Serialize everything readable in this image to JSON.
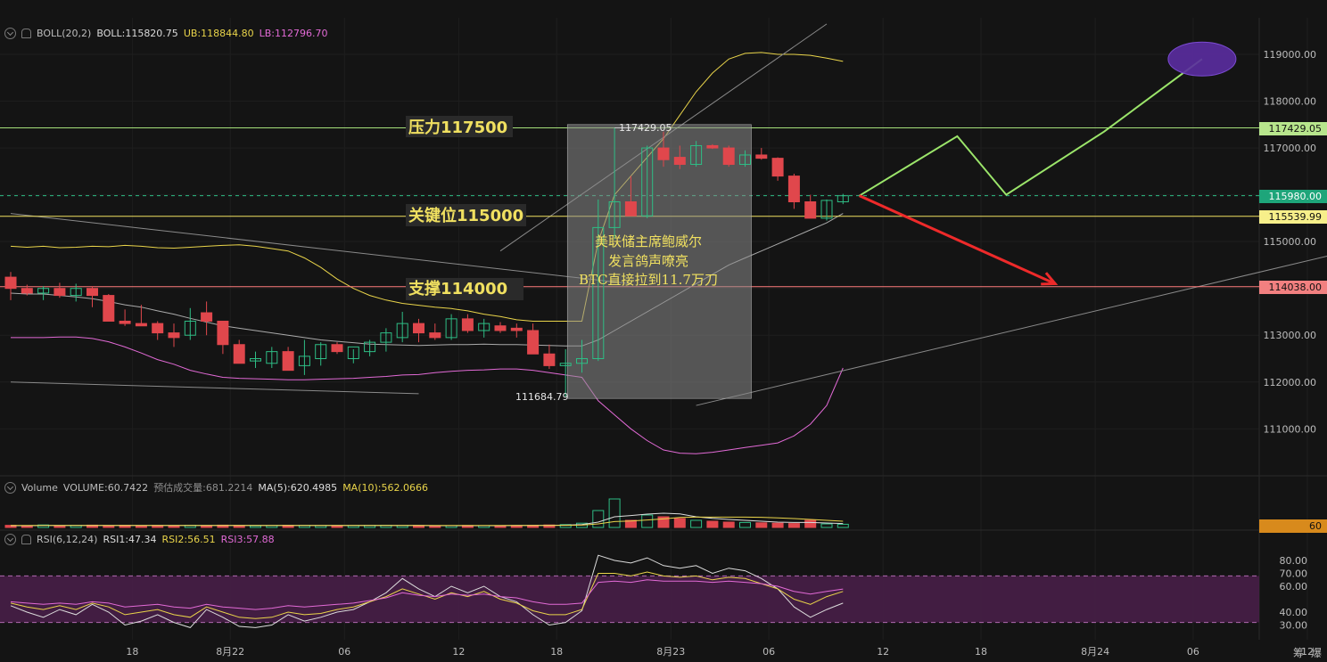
{
  "indicators": {
    "boll": {
      "label": "BOLL(20,2)",
      "mid": "BOLL:115820.75",
      "ub": "UB:118844.80",
      "lb": "LB:112796.70"
    },
    "volume": {
      "label": "Volume",
      "value": "VOLUME:60.7422",
      "estimate": "预估成交量:681.2214",
      "ma5": "MA(5):620.4985",
      "ma10": "MA(10):562.0666",
      "axis_value": "60"
    },
    "rsi": {
      "label": "RSI(6,12,24)",
      "rsi1": "RSI1:47.34",
      "rsi2": "RSI2:56.51",
      "rsi3": "RSI3:57.88"
    }
  },
  "annotations": {
    "resistance": "压力117500",
    "key_level": "关键位115000",
    "support": "支撑114000",
    "news_line1": "美联储主席鲍威尔",
    "news_line2": "发言鸽声嘹亮",
    "news_line3": "BTC直接拉到11.7万刀",
    "high_label": "117429.05",
    "low_label": "111684.79"
  },
  "price_tags": {
    "t117429": "117429.05",
    "t115980": "115980.00",
    "t115539": "115539.99",
    "t114038": "114038.00"
  },
  "bottom_icons": {
    "a": "筹",
    "b": "爆"
  },
  "colors": {
    "up": "#2ebd85",
    "down": "#e0474c",
    "boll_mid": "#cfcfcf",
    "boll_up": "#e9d44a",
    "boll_low": "#e26ad6",
    "resistance": "#a5e07a",
    "key": "#f0e060",
    "support": "#ff7d7d",
    "forecast": "#9be56a",
    "arrow": "#ee2a2a"
  },
  "chart_data": [
    {
      "type": "candlestick",
      "title": "",
      "y_axis_ticks": [
        119000,
        118000,
        117000,
        116000,
        115000,
        114000,
        113000,
        112000,
        111000
      ],
      "y_axis_labels": [
        "119000.00",
        "118000.00",
        "117000.00",
        "116000.00",
        "115000.00",
        "114000.00",
        "113000.00",
        "112000.00",
        "111000.00"
      ],
      "ylim": [
        110400,
        120050
      ],
      "x_ticks": [
        {
          "i": 8,
          "label": "18"
        },
        {
          "i": 14,
          "label": "8月22"
        },
        {
          "i": 21,
          "label": "06"
        },
        {
          "i": 28,
          "label": "12"
        },
        {
          "i": 34,
          "label": "18"
        },
        {
          "i": 41,
          "label": "8月23"
        },
        {
          "i": 47,
          "label": "06"
        },
        {
          "i": 54,
          "label": "12"
        },
        {
          "i": 60,
          "label": "18"
        },
        {
          "i": 67,
          "label": "8月24"
        },
        {
          "i": 73,
          "label": "06"
        },
        {
          "i": 80,
          "label": "12"
        }
      ],
      "levels": [
        {
          "name": "压力",
          "value": 117429.05
        },
        {
          "name": "关键位",
          "value": 115539.99
        },
        {
          "name": "支撑",
          "value": 114038.0
        },
        {
          "name": "current",
          "value": 115980.0
        }
      ],
      "candles": [
        [
          114240,
          114350,
          113750,
          114000
        ],
        [
          114000,
          114080,
          113850,
          113900
        ],
        [
          113900,
          114050,
          113750,
          114000
        ],
        [
          114000,
          114120,
          113800,
          113850
        ],
        [
          113850,
          114100,
          113720,
          114000
        ],
        [
          114000,
          114050,
          113600,
          113850
        ],
        [
          113850,
          113880,
          113500,
          113300
        ],
        [
          113300,
          113550,
          113200,
          113250
        ],
        [
          113250,
          113650,
          113200,
          113200
        ],
        [
          113250,
          113300,
          112900,
          113050
        ],
        [
          113050,
          113250,
          112750,
          112950
        ],
        [
          113000,
          113580,
          112900,
          113300
        ],
        [
          113480,
          113720,
          113000,
          113300
        ],
        [
          113300,
          113300,
          112600,
          112800
        ],
        [
          112800,
          112900,
          112450,
          112400
        ],
        [
          112450,
          112650,
          112300,
          112500
        ],
        [
          112400,
          112750,
          112300,
          112650
        ],
        [
          112650,
          112750,
          112250,
          112250
        ],
        [
          112350,
          112900,
          112150,
          112550
        ],
        [
          112500,
          112850,
          112350,
          112800
        ],
        [
          112800,
          112850,
          112600,
          112650
        ],
        [
          112500,
          112700,
          112400,
          112750
        ],
        [
          112650,
          112900,
          112550,
          112850
        ],
        [
          112850,
          113150,
          112650,
          113050
        ],
        [
          112950,
          113500,
          112850,
          113250
        ],
        [
          113250,
          113350,
          112850,
          113050
        ],
        [
          113050,
          113250,
          112900,
          112950
        ],
        [
          112950,
          113450,
          112900,
          113350
        ],
        [
          113350,
          113450,
          113050,
          113100
        ],
        [
          113100,
          113350,
          112950,
          113250
        ],
        [
          113200,
          113280,
          113050,
          113100
        ],
        [
          113150,
          113250,
          112950,
          113100
        ],
        [
          113100,
          113250,
          112650,
          112600
        ],
        [
          112600,
          112800,
          112280,
          112350
        ],
        [
          112350,
          112700,
          111684.79,
          112400
        ],
        [
          112400,
          112900,
          112200,
          112500
        ],
        [
          112500,
          115900,
          112450,
          115300
        ],
        [
          115300,
          117429.05,
          115050,
          115850
        ],
        [
          115850,
          116400,
          115650,
          115550
        ],
        [
          115550,
          117050,
          115500,
          117000
        ],
        [
          117000,
          117350,
          116600,
          116750
        ],
        [
          116800,
          117050,
          116550,
          116650
        ],
        [
          116650,
          117150,
          116600,
          117050
        ],
        [
          117050,
          117080,
          116980,
          117000
        ],
        [
          117000,
          117050,
          116600,
          116650
        ],
        [
          116650,
          116950,
          116600,
          116850
        ],
        [
          116850,
          117000,
          116750,
          116780
        ],
        [
          116780,
          116800,
          116300,
          116400
        ],
        [
          116400,
          116450,
          115700,
          115850
        ],
        [
          115850,
          116000,
          115500,
          115500
        ],
        [
          115500,
          115900,
          115450,
          115880
        ],
        [
          115850,
          116020,
          115800,
          115980
        ]
      ],
      "boll_upper": [
        114900,
        114880,
        114900,
        114870,
        114880,
        114900,
        114890,
        114920,
        114900,
        114870,
        114860,
        114880,
        114900,
        114920,
        114930,
        114900,
        114850,
        114800,
        114650,
        114450,
        114200,
        114000,
        113850,
        113750,
        113680,
        113640,
        113600,
        113570,
        113520,
        113450,
        113400,
        113330,
        113300,
        113300,
        113300,
        113300,
        115000,
        116000,
        116400,
        116800,
        117200,
        117700,
        118200,
        118600,
        118900,
        119020,
        119040,
        119000,
        119000,
        118980,
        118920,
        118850
      ],
      "boll_mid": [
        113900,
        113880,
        113880,
        113850,
        113820,
        113780,
        113720,
        113650,
        113600,
        113520,
        113450,
        113360,
        113280,
        113200,
        113150,
        113100,
        113050,
        113000,
        112950,
        112900,
        112870,
        112840,
        112810,
        112800,
        112790,
        112780,
        112790,
        112800,
        112800,
        112810,
        112800,
        112800,
        112790,
        112780,
        112770,
        112770,
        112900,
        113100,
        113300,
        113500,
        113700,
        113900,
        114100,
        114300,
        114500,
        114650,
        114800,
        114950,
        115100,
        115250,
        115400,
        115600
      ],
      "boll_lower": [
        112950,
        112950,
        112950,
        112960,
        112960,
        112930,
        112860,
        112750,
        112620,
        112480,
        112380,
        112250,
        112170,
        112100,
        112080,
        112070,
        112060,
        112050,
        112050,
        112060,
        112070,
        112080,
        112100,
        112120,
        112150,
        112160,
        112200,
        112230,
        112250,
        112260,
        112280,
        112280,
        112250,
        112200,
        112150,
        112100,
        111600,
        111300,
        111000,
        110750,
        110550,
        110480,
        110470,
        110500,
        110550,
        110600,
        110650,
        110700,
        110850,
        111100,
        111500,
        112300
      ],
      "trendlines": [
        {
          "from": [
            0,
            115600
          ],
          "to": [
            38,
            114100
          ]
        },
        {
          "from": [
            0,
            112000
          ],
          "to": [
            25,
            111750
          ]
        },
        {
          "from": [
            30,
            114800
          ],
          "to": [
            50,
            119650
          ]
        },
        {
          "from": [
            42,
            111500
          ],
          "to": [
            82,
            114800
          ]
        }
      ],
      "forecast_path": [
        [
          52,
          115980
        ],
        [
          58,
          117250
        ],
        [
          61,
          116000
        ],
        [
          67,
          117350
        ],
        [
          73,
          118900
        ]
      ],
      "forecast_target": [
        73,
        118900
      ],
      "bearish_arrow": {
        "from": [
          52,
          115980
        ],
        "to": [
          64,
          114100
        ]
      }
    },
    {
      "type": "bar",
      "title": "Volume",
      "values": [
        12,
        10,
        14,
        9,
        11,
        13,
        10,
        12,
        9,
        11,
        10,
        12,
        10,
        13,
        11,
        9,
        10,
        12,
        11,
        10,
        9,
        10,
        11,
        12,
        10,
        11,
        9,
        10,
        11,
        10,
        9,
        10,
        12,
        14,
        16,
        24,
        95,
        160,
        40,
        70,
        60,
        50,
        40,
        35,
        30,
        28,
        26,
        24,
        22,
        40,
        20,
        18
      ],
      "ma5": [
        10,
        10,
        11,
        11,
        11,
        11,
        11,
        11,
        11,
        11,
        11,
        11,
        11,
        11,
        11,
        11,
        11,
        11,
        11,
        11,
        11,
        11,
        11,
        11,
        11,
        11,
        10,
        10,
        10,
        10,
        10,
        11,
        11,
        12,
        13,
        16,
        30,
        60,
        67,
        75,
        80,
        76,
        60,
        51,
        45,
        40,
        35,
        30,
        28,
        28,
        25,
        22
      ],
      "ma10": [
        11,
        11,
        11,
        11,
        11,
        11,
        11,
        11,
        11,
        11,
        11,
        11,
        11,
        11,
        11,
        11,
        11,
        11,
        11,
        11,
        11,
        11,
        11,
        11,
        11,
        11,
        11,
        11,
        11,
        11,
        11,
        11,
        11,
        11,
        12,
        13,
        20,
        33,
        36,
        42,
        48,
        56,
        58,
        58,
        58,
        58,
        57,
        54,
        50,
        45,
        40,
        35
      ]
    },
    {
      "type": "line",
      "title": "RSI(6,12,24)",
      "ylim": [
        28,
        92
      ],
      "y_axis_labels": [
        "80.00",
        "70.00",
        "60.00",
        "40.00",
        "30.00"
      ],
      "y_axis_ticks": [
        80,
        70,
        60,
        40,
        30
      ],
      "band": [
        32,
        68
      ],
      "series": [
        {
          "name": "RSI1",
          "values": [
            45,
            40,
            36,
            42,
            38,
            46,
            40,
            30,
            33,
            38,
            32,
            28,
            42,
            36,
            29,
            28,
            30,
            38,
            33,
            36,
            40,
            42,
            48,
            55,
            66,
            58,
            52,
            60,
            55,
            60,
            52,
            48,
            38,
            30,
            32,
            41,
            84,
            80,
            78,
            82,
            76,
            74,
            76,
            70,
            74,
            72,
            66,
            58,
            44,
            36,
            42,
            47
          ]
        },
        {
          "name": "RSI2",
          "values": [
            47,
            44,
            42,
            45,
            42,
            47,
            44,
            38,
            40,
            42,
            38,
            36,
            44,
            40,
            36,
            35,
            36,
            40,
            38,
            39,
            42,
            44,
            48,
            52,
            58,
            54,
            50,
            55,
            52,
            56,
            50,
            47,
            41,
            38,
            38,
            42,
            70,
            70,
            68,
            71,
            68,
            67,
            68,
            65,
            67,
            66,
            62,
            58,
            50,
            46,
            52,
            56
          ]
        },
        {
          "name": "RSI3",
          "values": [
            48,
            47,
            46,
            47,
            46,
            48,
            47,
            44,
            45,
            46,
            44,
            43,
            46,
            44,
            43,
            42,
            43,
            45,
            44,
            45,
            46,
            47,
            49,
            51,
            55,
            53,
            52,
            54,
            53,
            54,
            52,
            51,
            48,
            46,
            46,
            47,
            63,
            64,
            63,
            65,
            64,
            64,
            64,
            63,
            64,
            63,
            62,
            60,
            56,
            54,
            56,
            57.88
          ]
        }
      ]
    }
  ]
}
